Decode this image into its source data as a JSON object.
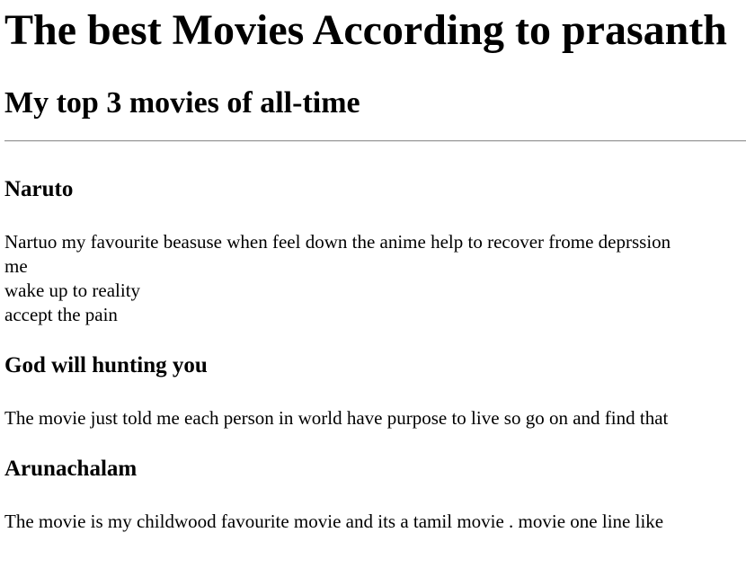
{
  "page": {
    "title": "The best Movies According to prasanth",
    "subtitle": "My top 3 movies of all-time"
  },
  "movies": [
    {
      "title": "Naruto",
      "lines": [
        "Nartuo my favourite beasuse when feel down the anime help to recover frome deprssion",
        "me",
        "wake up to reality",
        "accept the pain"
      ]
    },
    {
      "title": "God will hunting you",
      "lines": [
        "The movie just told me each person in world have purpose to live so go on and find that"
      ]
    },
    {
      "title": "Arunachalam",
      "lines": [
        "The movie is my childwood favourite movie and its a tamil movie . movie one line like"
      ]
    }
  ]
}
